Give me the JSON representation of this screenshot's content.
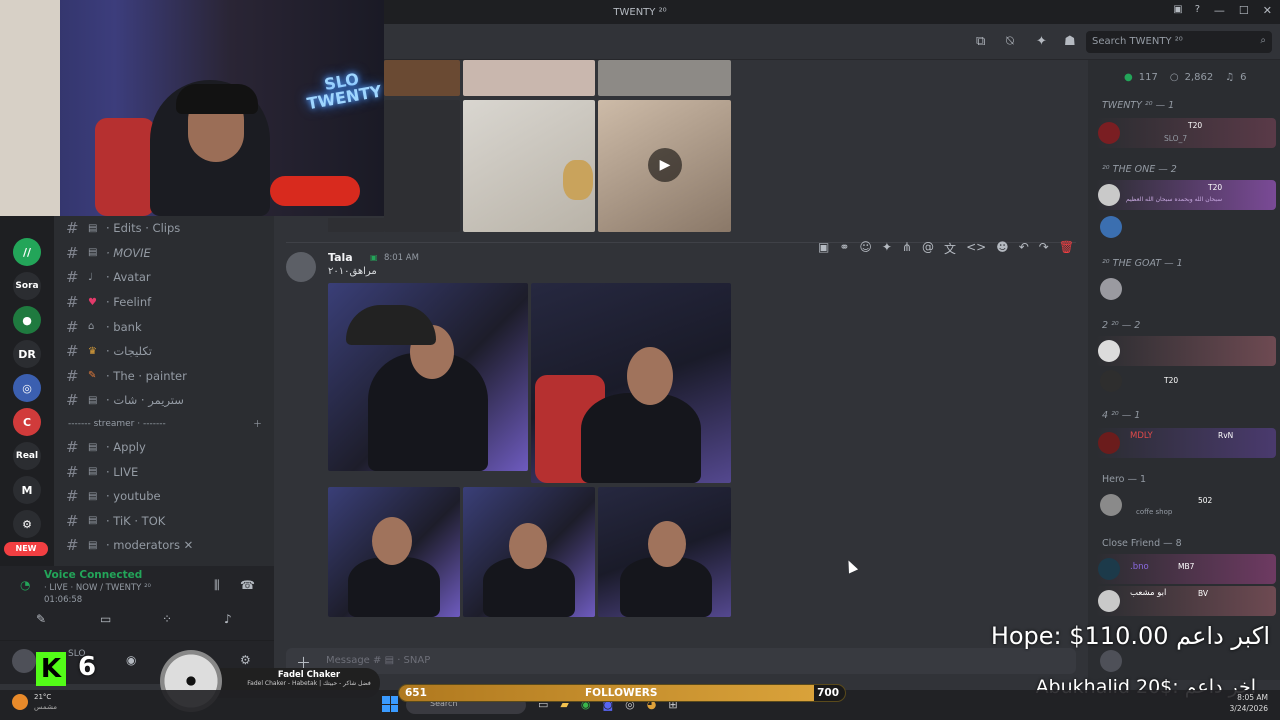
{
  "window": {
    "title": "TWENTY ²⁰"
  },
  "header": {
    "search_placeholder": "Search TWENTY ²⁰"
  },
  "channels": {
    "items": [
      {
        "emoji": "▤",
        "label": "· Edits · Clips"
      },
      {
        "emoji": "▤",
        "label": "· MOVIE"
      },
      {
        "emoji": "♩",
        "label": "· Avatar"
      },
      {
        "emoji": "♥",
        "label": "· Feelinf"
      },
      {
        "emoji": "⌂",
        "label": "· bank"
      },
      {
        "emoji": "♛",
        "label": "· تكليجات"
      },
      {
        "emoji": "✎",
        "label": "· The · painter"
      },
      {
        "emoji": "▤",
        "label": "· ستريمر · شات"
      }
    ],
    "category": "------- streamer · -------",
    "streamer_items": [
      {
        "emoji": "▤",
        "label": "· Apply"
      },
      {
        "emoji": "▤",
        "label": "· LIVE"
      },
      {
        "emoji": "▤",
        "label": "· youtube"
      },
      {
        "emoji": "▤",
        "label": "· TiK · TOK"
      },
      {
        "emoji": "▤",
        "label": "· moderators ✕"
      }
    ]
  },
  "servers": {
    "new_badge": "NEW",
    "items": [
      {
        "abbr": "//",
        "color": "#23a559"
      },
      {
        "abbr": "Sora",
        "color": "#2b2d31"
      },
      {
        "abbr": "●",
        "color": "#1f7a3f"
      },
      {
        "abbr": "DR",
        "color": "#2b2d31"
      },
      {
        "abbr": "◎",
        "color": "#3b5fb0"
      },
      {
        "abbr": "C",
        "color": "#d13b3b"
      },
      {
        "abbr": "Real",
        "color": "#2b2d31"
      },
      {
        "abbr": "M",
        "color": "#2b2d31"
      },
      {
        "abbr": "⚙",
        "color": "#2b2d31"
      }
    ]
  },
  "voice": {
    "status": "Voice Connected",
    "channel": "· LIVE · NOW / TWENTY ²⁰",
    "timer": "01:06:58"
  },
  "message": {
    "author": "Tala",
    "time": "8:01 AM",
    "text": "مراهق٢٠١٠"
  },
  "members": {
    "online": "117",
    "total": "2,862",
    "voice": "6",
    "groups": [
      {
        "label": "TWENTY ²⁰ — 1"
      },
      {
        "label": "²⁰ THE ONE — 2"
      },
      {
        "label": "²⁰ THE GOAT — 1"
      },
      {
        "label": "2 ²⁰ — 2"
      },
      {
        "label": "4 ²⁰ — 1"
      },
      {
        "label": "Hero — 1"
      },
      {
        "label": "Close Friend — 8"
      }
    ],
    "names": {
      "m1": "SLO_7",
      "m2": "سبحان الله وبحمده سبحان الله العظيم",
      "m3": "coffe shop",
      "m4": "MDLY",
      "m5": "ابو مشعب",
      "m6": ".bno"
    },
    "badges": {
      "t20": "T20",
      "rvn": "RvN",
      "b502": "502",
      "mb7": "MB7",
      "bv": "BV"
    }
  },
  "composer": {
    "placeholder": "Message # ▤ · SNAP"
  },
  "overlay": {
    "top_donor": "Hope: $110.00 اكبر داعم",
    "last_donor": "Abukhalid 20$: اخر داعم",
    "followers_label": "FOLLOWERS",
    "followers_current": "651",
    "followers_goal": "700",
    "followers_progress": 0.93,
    "music_artist": "Fadel Chaker",
    "music_track": "Fadel Chaker - Habetak | فضل شاكر - حبيتك",
    "kick_count": "6",
    "neon_text": "SLO TWENTY"
  },
  "user": {
    "name": "SLO"
  },
  "taskbar": {
    "weather": "21°C",
    "weather_desc": "مشمس",
    "search": "Search",
    "time": "8:05 AM",
    "date": "3/24/2026"
  },
  "accent": "#5865f2"
}
